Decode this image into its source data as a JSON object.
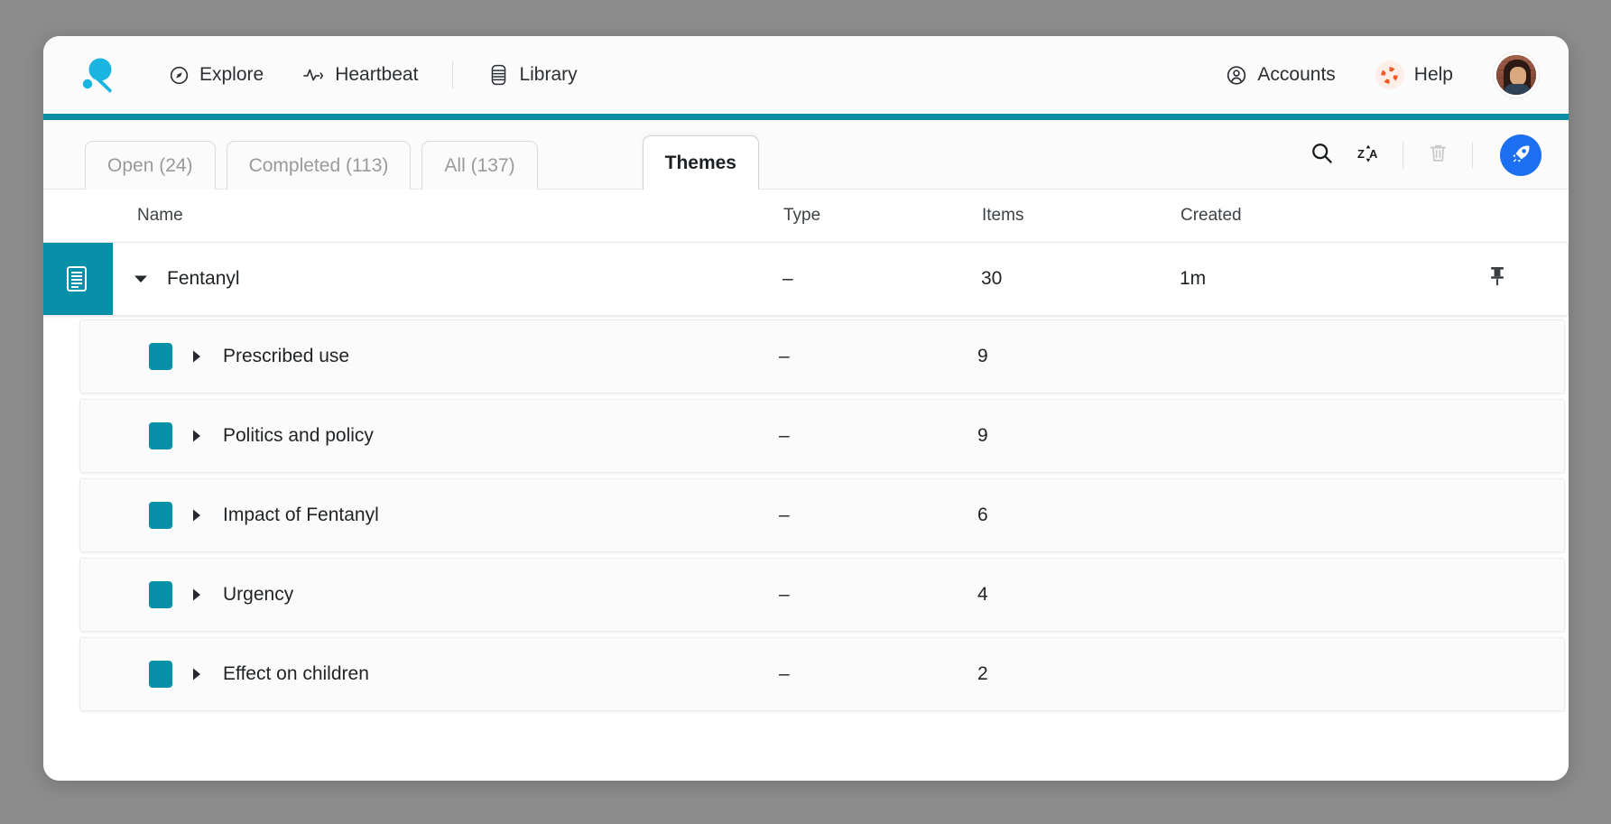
{
  "app": {
    "logo_icon": "lookback-logo-icon",
    "accent_teal": "#0790a8",
    "accent_blue": "#1b6ff0",
    "accent_orange": "#ef5b25"
  },
  "header": {
    "nav": [
      {
        "label": "Explore",
        "icon": "compass-icon"
      },
      {
        "label": "Heartbeat",
        "icon": "pulse-icon"
      },
      {
        "label": "Library",
        "icon": "database-icon"
      }
    ],
    "right": [
      {
        "label": "Accounts",
        "icon": "account-circle-icon"
      },
      {
        "label": "Help",
        "icon": "lifebuoy-icon"
      }
    ],
    "avatar_alt": "user-avatar"
  },
  "tabs": [
    {
      "label": "Open (24)",
      "active": false
    },
    {
      "label": "Completed (113)",
      "active": false
    },
    {
      "label": "All (137)",
      "active": false
    },
    {
      "label": "Themes",
      "active": true
    }
  ],
  "toolbar": {
    "search_icon": "search-icon",
    "sort_icon": "sort-za-icon",
    "delete_icon": "trash-icon",
    "launch_icon": "rocket-icon"
  },
  "table": {
    "columns": {
      "name": "Name",
      "type": "Type",
      "items": "Items",
      "created": "Created"
    },
    "parent": {
      "icon": "theme-list-icon",
      "caret": "caret-down-icon",
      "name": "Fentanyl",
      "type": "–",
      "items": "30",
      "created": "1m",
      "pin_icon": "pin-icon"
    },
    "children": [
      {
        "caret": "caret-right-icon",
        "swatch_color": "#0790a8",
        "name": "Prescribed use",
        "type": "–",
        "items": "9"
      },
      {
        "caret": "caret-right-icon",
        "swatch_color": "#0790a8",
        "name": "Politics and policy",
        "type": "–",
        "items": "9"
      },
      {
        "caret": "caret-right-icon",
        "swatch_color": "#0790a8",
        "name": "Impact of Fentanyl",
        "type": "–",
        "items": "6"
      },
      {
        "caret": "caret-right-icon",
        "swatch_color": "#0790a8",
        "name": "Urgency",
        "type": "–",
        "items": "4"
      },
      {
        "caret": "caret-right-icon",
        "swatch_color": "#0790a8",
        "name": "Effect on children",
        "type": "–",
        "items": "2"
      }
    ]
  }
}
